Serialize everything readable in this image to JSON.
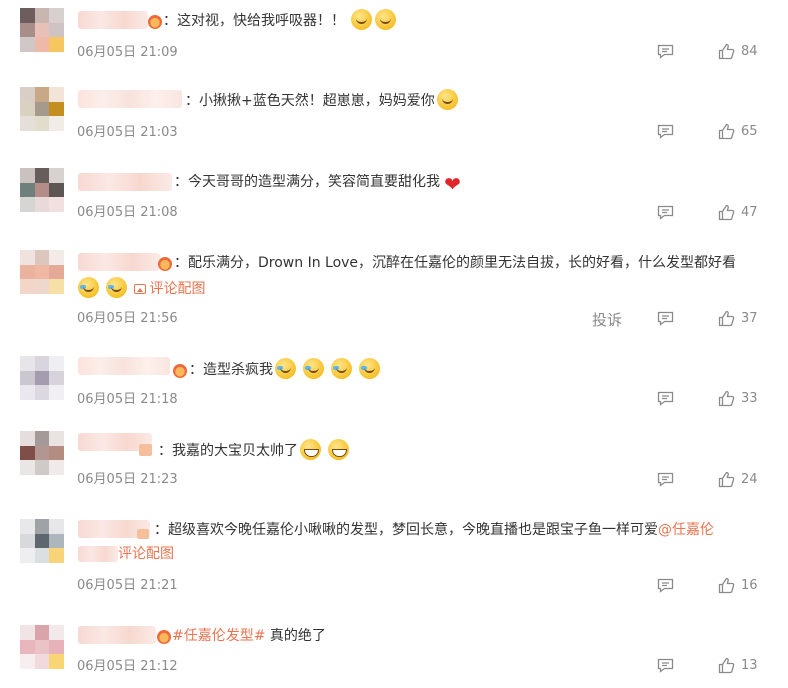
{
  "colors": {
    "link": "#eb7350",
    "meta": "#8a8a8a",
    "text": "#333333",
    "heart": "#e0252b"
  },
  "actions": {
    "report_label": "投诉",
    "reply_icon": "comment-icon",
    "like_icon": "thumbs-up-icon"
  },
  "comments": [
    {
      "text": "：这对视，快给我呼吸器！！",
      "time": "06月05日 21:09",
      "likes": "84",
      "emojis": [
        "surprised-emoji",
        "surprised-emoji"
      ]
    },
    {
      "text": "：小揪揪+蓝色天然！超崽崽，妈妈爱你",
      "time": "06月05日 21:03",
      "likes": "65",
      "emojis": [
        "kiss-emoji"
      ]
    },
    {
      "text": "：今天哥哥的造型满分，笑容简直要甜化我",
      "time": "06月05日 21:08",
      "likes": "47",
      "emojis": [
        "heart-emoji"
      ]
    },
    {
      "text": "：配乐满分，Drown In Love，沉醉在任嘉伦的颜里无法自拔，长的好看，什么发型都好看",
      "time": "06月05日 21:56",
      "likes": "37",
      "emojis": [
        "crying-laugh-emoji",
        "crying-laugh-emoji"
      ],
      "pic_label": "评论配图"
    },
    {
      "text": "：造型杀疯我",
      "time": "06月05日 21:18",
      "likes": "33",
      "emojis": [
        "laugh-cry-emoji",
        "laugh-cry-emoji",
        "laugh-cry-emoji",
        "laugh-cry-emoji"
      ]
    },
    {
      "text": "：我嘉的大宝贝太帅了",
      "time": "06月05日 21:23",
      "likes": "24",
      "emojis": [
        "grin-emoji",
        "grin-emoji"
      ]
    },
    {
      "text": "：超级喜欢今晚任嘉伦小啾啾的发型，梦回长意，今晚直播也是跟宝子鱼一样可爱",
      "mention": "@任嘉伦",
      "time": "06月05日 21:21",
      "likes": "16",
      "pic_label": "评论配图"
    },
    {
      "hashtag": "#任嘉伦发型#",
      "text": " 真的绝了",
      "time": "06月05日 21:12",
      "likes": "13"
    }
  ]
}
